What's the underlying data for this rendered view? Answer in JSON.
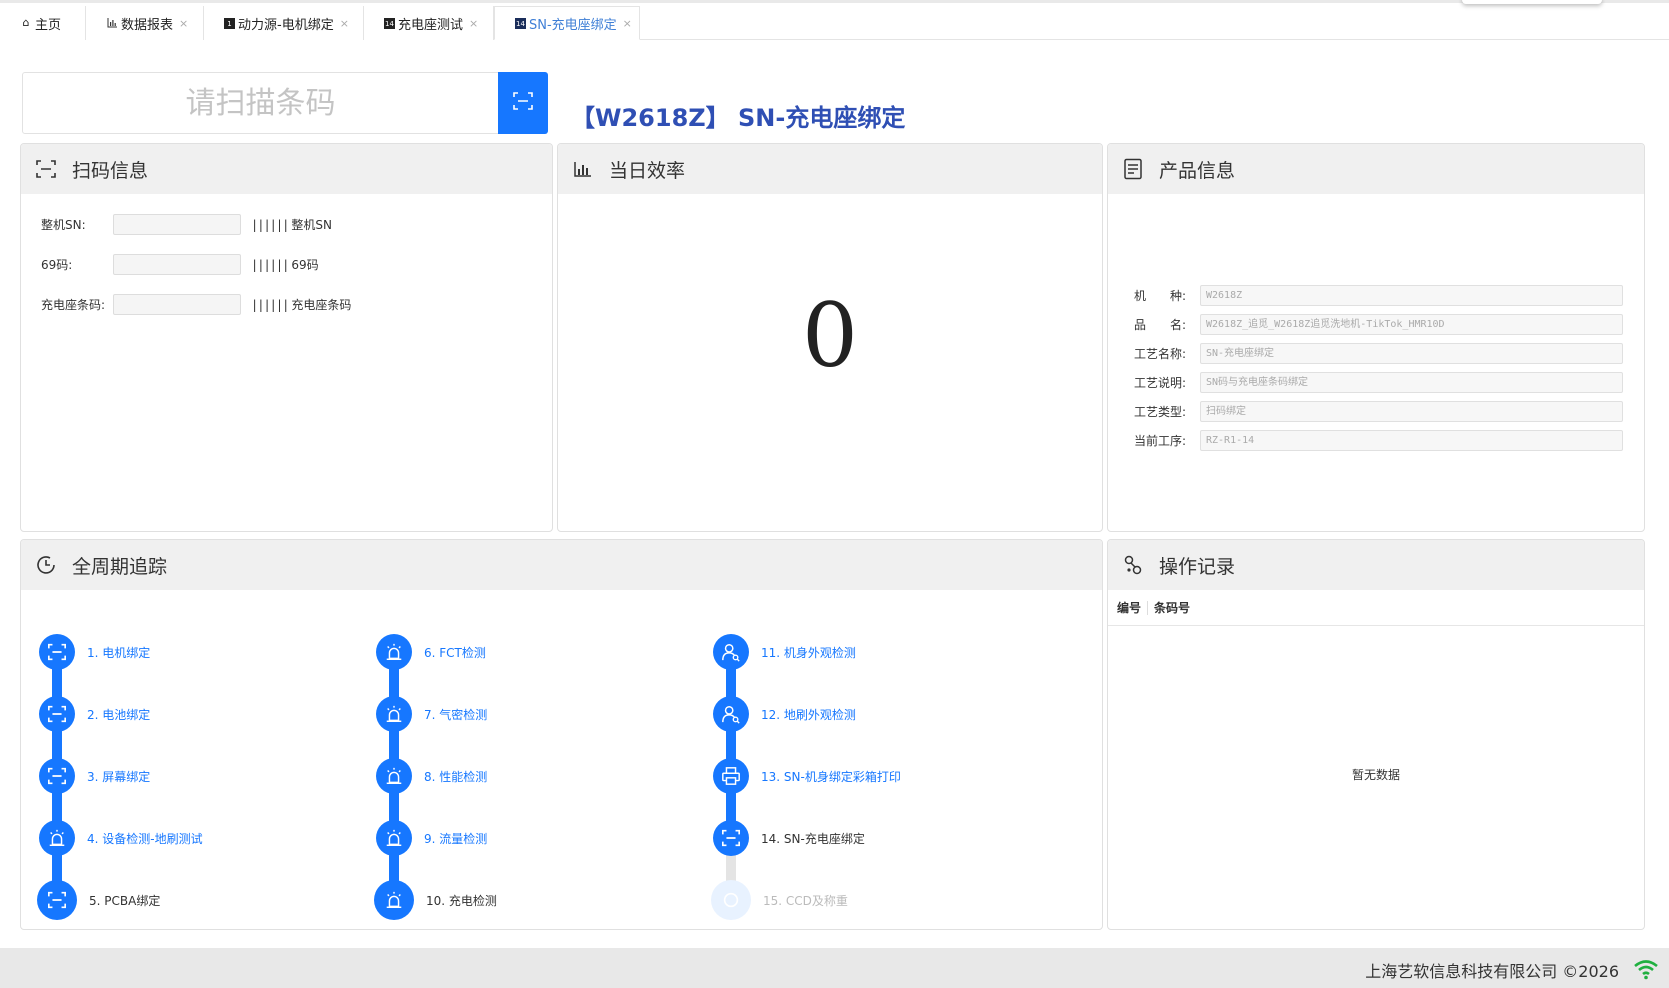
{
  "tabs": [
    {
      "label": "主页",
      "icon": "home-icon",
      "closable": false
    },
    {
      "label": "数据报表",
      "icon": "chart-icon",
      "closable": true
    },
    {
      "label": "动力源-电机绑定",
      "icon": "badge-icon",
      "badge": "1",
      "closable": true
    },
    {
      "label": "充电座测试",
      "icon": "badge-icon",
      "badge": "14",
      "closable": true
    },
    {
      "label": "SN-充电座绑定",
      "icon": "badge-icon",
      "badge": "14",
      "closable": true,
      "active": true
    }
  ],
  "tab_close": "×",
  "scan": {
    "placeholder": "请扫描条码",
    "button_icon": "scan-icon"
  },
  "page_title": "【W2618Z】 SN-充电座绑定",
  "scan_info": {
    "title": "扫码信息",
    "rows": [
      {
        "label": "整机SN:",
        "barcode_label": "整机SN",
        "value": ""
      },
      {
        "label": "69码:",
        "barcode_label": "69码",
        "value": ""
      },
      {
        "label": "充电座条码:",
        "barcode_label": "充电座条码",
        "value": ""
      }
    ]
  },
  "efficiency": {
    "title": "当日效率",
    "value": "0"
  },
  "product_info": {
    "title": "产品信息",
    "rows": [
      {
        "label": "机　　种:",
        "value": "W2618Z"
      },
      {
        "label": "品　　名:",
        "value": "W2618Z_追觅_W2618Z追觅洗地机-TikTok_HMR10D"
      },
      {
        "label": "工艺名称:",
        "value": "SN-充电座绑定"
      },
      {
        "label": "工艺说明:",
        "value": "SN码与充电座条码绑定"
      },
      {
        "label": "工艺类型:",
        "value": "扫码绑定"
      },
      {
        "label": "当前工序:",
        "value": "RZ-R1-14"
      }
    ]
  },
  "lifecycle": {
    "title": "全周期追踪",
    "steps": [
      {
        "label": "1. 电机绑定",
        "icon": "scan-icon",
        "status": "done"
      },
      {
        "label": "2. 电池绑定",
        "icon": "scan-icon",
        "status": "done"
      },
      {
        "label": "3. 屏幕绑定",
        "icon": "scan-icon",
        "status": "done"
      },
      {
        "label": "4. 设备检测-地刷测试",
        "icon": "alarm-icon",
        "status": "done"
      },
      {
        "label": "5. PCBA绑定",
        "icon": "scan-icon",
        "status": "done-dark"
      },
      {
        "label": "6. FCT检测",
        "icon": "alarm-icon",
        "status": "done"
      },
      {
        "label": "7. 气密检测",
        "icon": "alarm-icon",
        "status": "done"
      },
      {
        "label": "8. 性能检测",
        "icon": "alarm-icon",
        "status": "done"
      },
      {
        "label": "9. 流量检测",
        "icon": "alarm-icon",
        "status": "done"
      },
      {
        "label": "10. 充电检测",
        "icon": "alarm-icon",
        "status": "done-dark"
      },
      {
        "label": "11. 机身外观检测",
        "icon": "inspector-icon",
        "status": "done"
      },
      {
        "label": "12. 地刷外观检测",
        "icon": "inspector-icon",
        "status": "done"
      },
      {
        "label": "13. SN-机身绑定彩箱打印",
        "icon": "printer-icon",
        "status": "done"
      },
      {
        "label": "14. SN-充电座绑定",
        "icon": "scan-icon",
        "status": "current"
      },
      {
        "label": "15. CCD及称重",
        "icon": "circle-icon",
        "status": "pending"
      }
    ]
  },
  "operation_log": {
    "title": "操作记录",
    "columns": [
      "编号",
      "条码号"
    ],
    "rows": [],
    "empty_text": "暂无数据"
  },
  "footer": {
    "copyright": "上海艺软信息科技有限公司 ©2026",
    "status_icon": "wifi-icon"
  },
  "colors": {
    "accent": "#1677ff",
    "title": "#2f4fb4",
    "pending": "#e8f2ff"
  }
}
